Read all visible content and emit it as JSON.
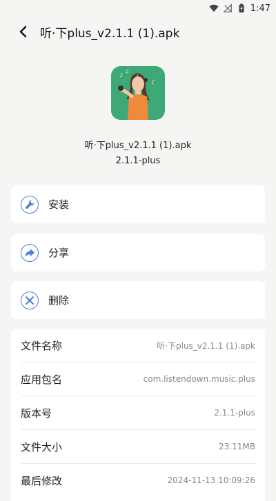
{
  "status": {
    "time": "1:47"
  },
  "header": {
    "title": "听·下plus_v2.1.1 (1).apk"
  },
  "app": {
    "name": "听·下plus_v2.1.1 (1).apk",
    "version": "2.1.1-plus"
  },
  "actions": [
    {
      "label": "安装",
      "icon": "wrench-icon"
    },
    {
      "label": "分享",
      "icon": "share-icon"
    },
    {
      "label": "删除",
      "icon": "close-icon"
    }
  ],
  "info": [
    {
      "label": "文件名称",
      "value": "听·下plus_v2.1.1 (1).apk"
    },
    {
      "label": "应用包名",
      "value": "com.listendown.music.plus"
    },
    {
      "label": "版本号",
      "value": "2.1.1-plus"
    },
    {
      "label": "文件大小",
      "value": "23.11MB"
    },
    {
      "label": "最后修改",
      "value": "2024-11-13 10:09:26"
    }
  ],
  "colors": {
    "accent": "#4a7fd4",
    "background": "#f5f5f3",
    "icon_bg": "#3fa877"
  }
}
